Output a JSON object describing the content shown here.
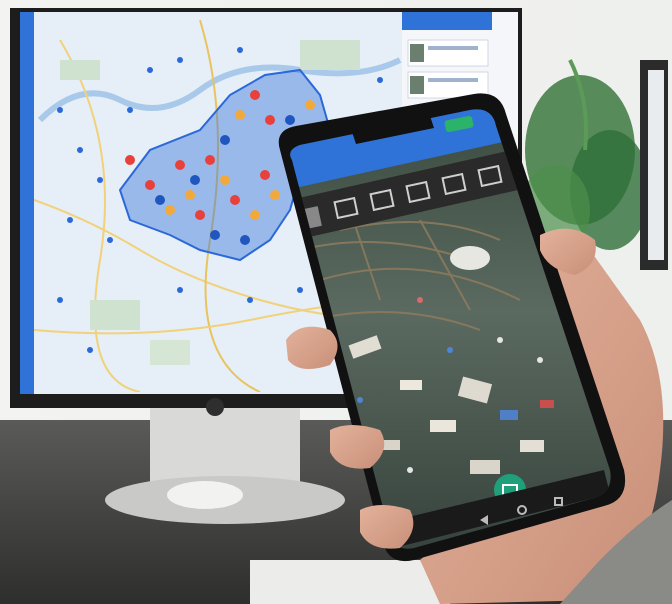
{
  "scene": {
    "description_tag": "photo",
    "monitor": {
      "map": {
        "region_color": "#3c77d9",
        "marker_colors": {
          "red": "#e8413c",
          "orange": "#f2a93b",
          "yellow": "#f7d24a",
          "blue": "#2b68d8"
        }
      },
      "header_bar_color": "#2f73d8"
    },
    "phone": {
      "header_color": "#2f73d8",
      "action_button_color": "#2cb36a",
      "fab_color": "#1f9f7a",
      "nav_icons": [
        "back-icon",
        "home-icon",
        "recent-apps-icon"
      ],
      "toolbar_icons": [
        "camera-icon",
        "camera-icon",
        "camera-icon",
        "camera-icon",
        "camera-icon"
      ]
    },
    "colors": {
      "background": "#f4f4f2",
      "desk": "#3a3a38",
      "hand": "#d9a68f",
      "plant": "#2f6f3a"
    }
  }
}
